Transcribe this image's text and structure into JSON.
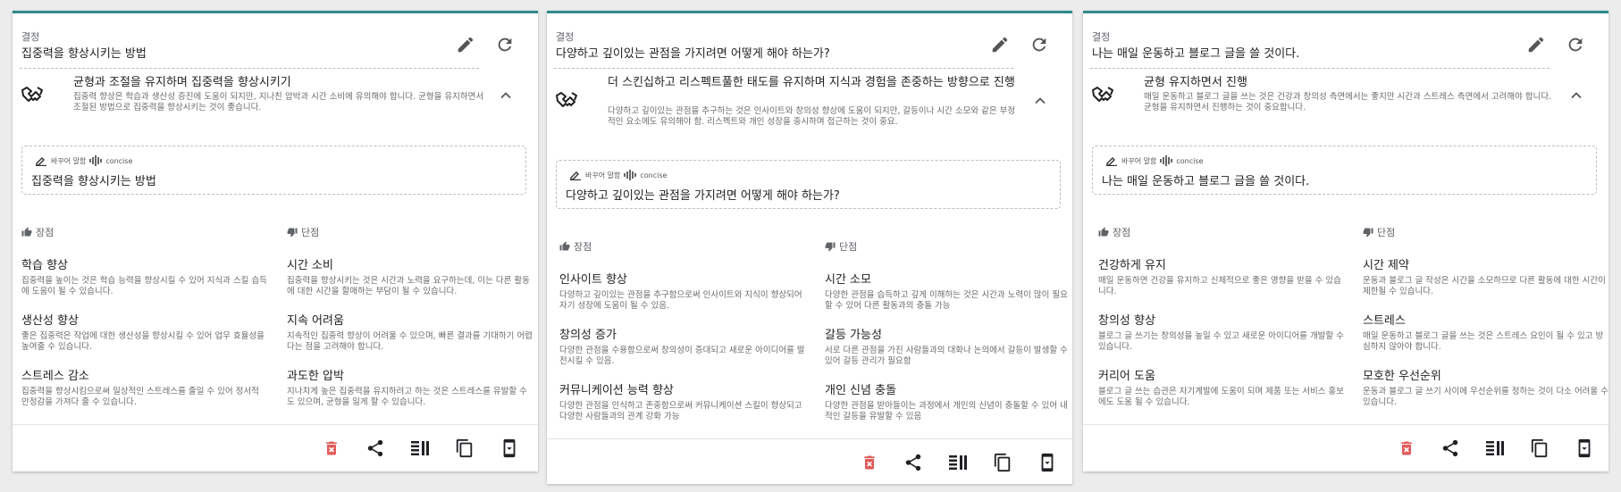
{
  "cards": [
    {
      "header": {
        "label": "결정",
        "title": "집중력을 향상시키는 방법"
      },
      "decision": {
        "title": "균형과 조절을 유지하며 집중력을 향상시키기",
        "description": "집중력 향상은 학습과 생산성 증진에 도움이 되지만, 지나친 압박과 시간 소비에 유의해야 합니다. 균형을 유지하면서 조절된 방법으로 집중력을 향상시키는 것이 좋습니다."
      },
      "rephrase": {
        "label": "바꾸어 말함",
        "mode": "concise",
        "text": "집중력을 향상시키는 방법"
      },
      "pros": {
        "label": "장점",
        "items": [
          {
            "title": "학습 향상",
            "desc": "집중력을 높이는 것은 학습 능력을 향상시킬 수 있어 지식과 스킬 습득에 도움이 될 수 있습니다."
          },
          {
            "title": "생산성 향상",
            "desc": "좋은 집중력은 작업에 대한 생산성을 향상시킬 수 있어 업무 효율성을 높여줄 수 있습니다."
          },
          {
            "title": "스트레스 감소",
            "desc": "집중력을 향상시킴으로써 일상적인 스트레스를 줄일 수 있어 정서적 안정감을 가져다 줄 수 있습니다."
          }
        ]
      },
      "cons": {
        "label": "단점",
        "items": [
          {
            "title": "시간 소비",
            "desc": "집중력을 향상시키는 것은 시간과 노력을 요구하는데, 이는 다른 활동에 대한 시간을 할애하는 부담이 될 수 있습니다."
          },
          {
            "title": "지속 어려움",
            "desc": "지속적인 집중력 향상이 어려울 수 있으며, 빠른 결과를 기대하기 어렵다는 점을 고려해야 합니다."
          },
          {
            "title": "과도한 압박",
            "desc": "지나치게 높은 집중력을 유지하려고 하는 것은 스트레스를 유발할 수도 있으며, 균형을 잃게 할 수 있습니다."
          }
        ]
      }
    },
    {
      "header": {
        "label": "결정",
        "title": "다양하고 깊이있는 관점을 가지려면 어떻게 해야 하는가?"
      },
      "decision": {
        "title": "더 스킨십하고 리스펙트풀한 태도를 유지하며 지식과 경험을 존중하는 방향으로 진행",
        "description": "다양하고 깊이있는 관점을 추구하는 것은 인사이트와 창의성 향상에 도움이 되지만, 갈등이나 시간 소모와 같은 부정적인 요소에도 유의해야 함. 리스펙트와 개인 성장을 중시하며 접근하는 것이 중요."
      },
      "rephrase": {
        "label": "바꾸어 말함",
        "mode": "concise",
        "text": "다양하고 깊이있는 관점을 가지려면 어떻게 해야 하는가?"
      },
      "pros": {
        "label": "장점",
        "items": [
          {
            "title": "인사이트 향상",
            "desc": "다양하고 깊이있는 관점을 추구함으로써 인사이트와 지식이 향상되어 자기 성장에 도움이 될 수 있음."
          },
          {
            "title": "창의성 증가",
            "desc": "다양한 관점을 수용함으로써 창의성이 증대되고 새로운 아이디어를 발전시킬 수 있음."
          },
          {
            "title": "커뮤니케이션 능력 향상",
            "desc": "다양한 관점을 인식하고 존중함으로써 커뮤니케이션 스킬이 향상되고 다양한 사람들과의 관계 강화 가능"
          }
        ]
      },
      "cons": {
        "label": "단점",
        "items": [
          {
            "title": "시간 소모",
            "desc": "다양한 관점을 습득하고 깊게 이해하는 것은 시간과 노력이 많이 필요할 수 있어 다른 활동과의 충돌 가능"
          },
          {
            "title": "갈등 가능성",
            "desc": "서로 다른 관점을 가진 사람들과의 대화나 논의에서 갈등이 발생할 수 있어 갈등 관리가 필요함"
          },
          {
            "title": "개인 신념 충돌",
            "desc": "다양한 관점을 받아들이는 과정에서 개인의 신념이 충돌할 수 있어 내적인 갈등을 유발할 수 있음"
          }
        ]
      }
    },
    {
      "header": {
        "label": "결정",
        "title": "나는 매일 운동하고 블로그 글을 쓸 것이다."
      },
      "decision": {
        "title": "균형 유지하면서 진행",
        "description": "매일 운동하고 블로그 글을 쓰는 것은 건강과 창의성 측면에서는 좋지만 시간과 스트레스 측면에서 고려해야 합니다. 균형을 유지하면서 진행하는 것이 중요합니다."
      },
      "rephrase": {
        "label": "바꾸어 말함",
        "mode": "concise",
        "text": "나는 매일 운동하고 블로그 글을 쓸 것이다."
      },
      "pros": {
        "label": "장점",
        "items": [
          {
            "title": "건강하게 유지",
            "desc": "매일 운동하면 건강을 유지하고 신체적으로 좋은 영향을 받을 수 있습니다."
          },
          {
            "title": "창의성 향상",
            "desc": "블로그 글 쓰기는 창의성을 높일 수 있고 새로운 아이디어를 개발할 수 있습니다."
          },
          {
            "title": "커리어 도움",
            "desc": "블로그 글 쓰는 습관은 자기계발에 도움이 되며 제품 또는 서비스 홍보에도 도움 될 수 있습니다."
          }
        ]
      },
      "cons": {
        "label": "단점",
        "items": [
          {
            "title": "시간 제약",
            "desc": "운동과 블로그 글 작성은 시간을 소모하므로 다른 활동에 대한 시간이 제한될 수 있습니다."
          },
          {
            "title": "스트레스",
            "desc": "매일 운동하고 블로그 글을 쓰는 것은 스트레스 요인이 될 수 있고 방심하지 않아야 합니다."
          },
          {
            "title": "모호한 우선순위",
            "desc": "운동과 블로그 글 쓰기 사이에 우선순위를 정하는 것이 다소 어려울 수 있습니다."
          }
        ]
      }
    }
  ],
  "icons": {
    "edit": "pencil-icon",
    "refresh": "refresh-icon",
    "decision": "handshake-icon",
    "collapse": "chevron-up-icon",
    "rephrase": "rephrase-icon",
    "mode": "waveform-icon",
    "pro": "thumb-up-icon",
    "con": "thumb-down-icon",
    "delete": "trash-icon",
    "share": "share-icon",
    "columns": "columns-icon",
    "copy": "copy-icon",
    "mobile": "mobile-icon"
  },
  "colors": {
    "accent": "#2f8a8c",
    "delete": "#e05a5a"
  }
}
